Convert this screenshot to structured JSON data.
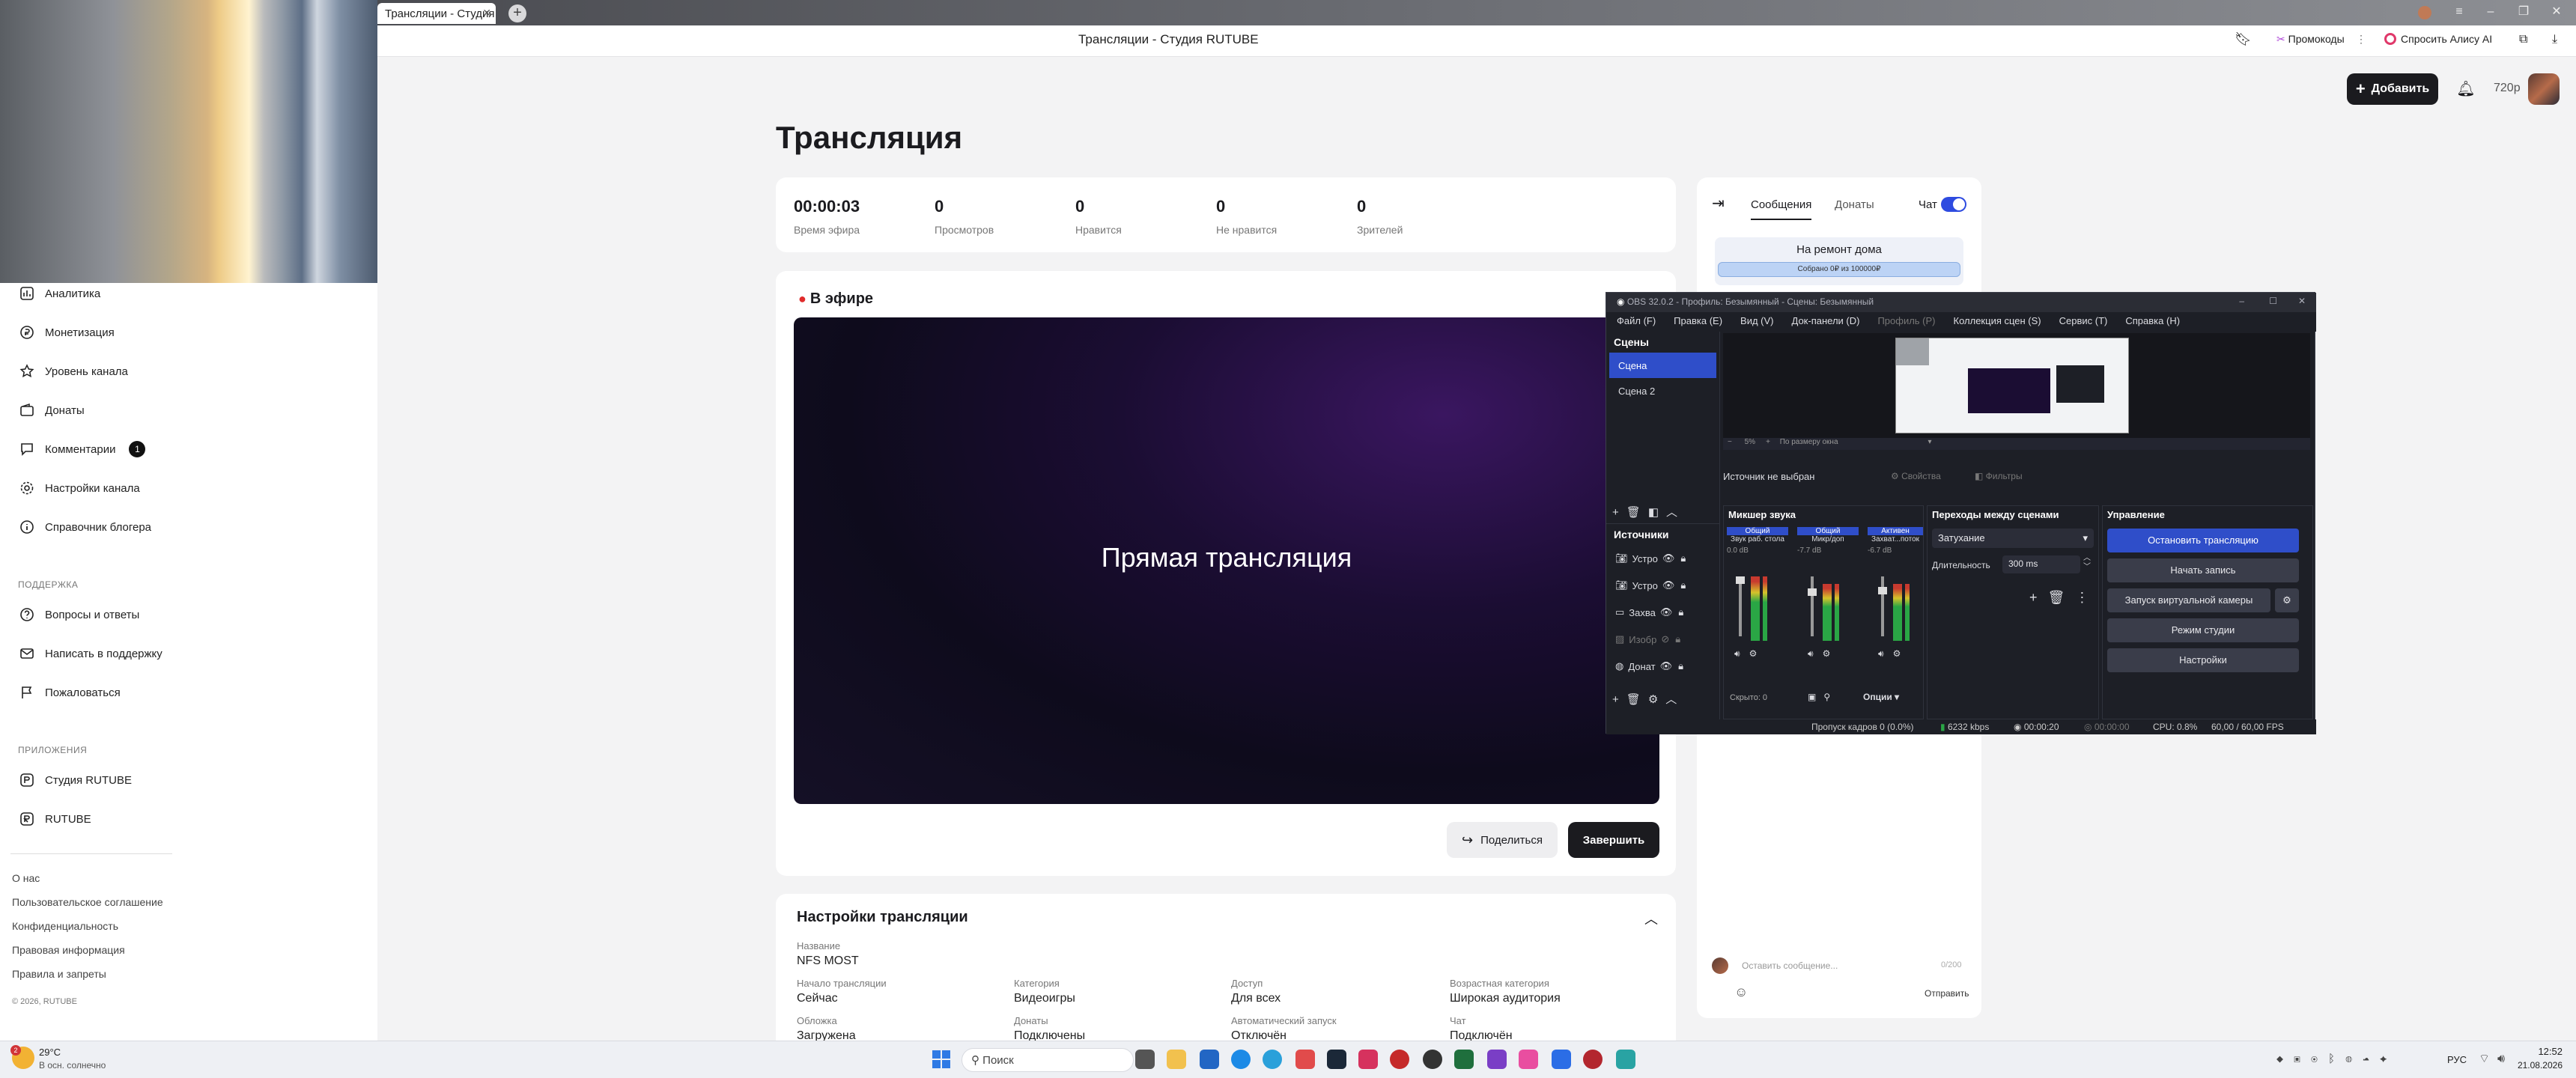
{
  "browser": {
    "tab_title": "Трансляции - Студия R",
    "page_title": "Трансляции - Студия RUTUBE",
    "actions": {
      "promo": "Промокоды",
      "ask": "Спросить Алису AI"
    }
  },
  "header": {
    "add_label": "Добавить",
    "quality": "720p"
  },
  "sidebar": {
    "items": [
      {
        "label": "Аналитика",
        "icon": "analytics-icon"
      },
      {
        "label": "Монетизация",
        "icon": "coin-icon"
      },
      {
        "label": "Уровень канала",
        "icon": "star-icon"
      },
      {
        "label": "Донаты",
        "icon": "wallet-icon"
      },
      {
        "label": "Комментарии",
        "icon": "comment-icon",
        "badge": "1"
      },
      {
        "label": "Настройки канала",
        "icon": "gear-icon"
      },
      {
        "label": "Справочник блогера",
        "icon": "info-icon"
      }
    ],
    "support_header": "ПОДДЕРЖКА",
    "support_items": [
      {
        "label": "Вопросы и ответы",
        "icon": "question-icon"
      },
      {
        "label": "Написать в поддержку",
        "icon": "mail-icon"
      },
      {
        "label": "Пожаловаться",
        "icon": "flag-icon"
      }
    ],
    "apps_header": "ПРИЛОЖЕНИЯ",
    "apps_items": [
      {
        "label": "Студия RUTUBE",
        "icon": "studio-icon"
      },
      {
        "label": "RUTUBE",
        "icon": "rutube-icon"
      }
    ],
    "footer_links": [
      "О нас",
      "Пользовательское соглашение",
      "Конфиденциальность",
      "Правовая информация",
      "Правила и запреты"
    ],
    "copyright": "© 2026, RUTUBE"
  },
  "main": {
    "title": "Трансляция",
    "stats": [
      {
        "value": "00:00:03",
        "label": "Время эфира"
      },
      {
        "value": "0",
        "label": "Просмотров"
      },
      {
        "value": "0",
        "label": "Нравится"
      },
      {
        "value": "0",
        "label": "Не нравится"
      },
      {
        "value": "0",
        "label": "Зрителей"
      }
    ],
    "live_label": "В эфире",
    "player_text": "Прямая трансляция",
    "share_label": "Поделиться",
    "finish_label": "Завершить",
    "settings": {
      "title": "Настройки трансляции",
      "name_label": "Название",
      "name_value": "NFS MOST",
      "fields": [
        {
          "label": "Начало трансляции",
          "value": "Сейчас"
        },
        {
          "label": "Категория",
          "value": "Видеоигры"
        },
        {
          "label": "Доступ",
          "value": "Для всех"
        },
        {
          "label": "Возрастная категория",
          "value": "Широкая аудитория"
        },
        {
          "label": "Обложка",
          "value": "Загружена"
        },
        {
          "label": "Донаты",
          "value": "Подключены"
        },
        {
          "label": "Автоматический запуск",
          "value": "Отключён"
        },
        {
          "label": "Чат",
          "value": "Подключён"
        }
      ]
    }
  },
  "chat": {
    "tabs": [
      "Сообщения",
      "Донаты"
    ],
    "chat_toggle_label": "Чат",
    "chat_enabled": true,
    "goal_title": "На ремонт дома",
    "goal_progress": "Собрано 0₽ из 100000₽",
    "goal_fraction": 0,
    "input_placeholder": "Оставить сообщение...",
    "char_count": "0/200",
    "send_label": "Отправить"
  },
  "obs": {
    "title": "OBS 32.0.2 - Профиль: Безымянный - Сцены: Безымянный",
    "menu": [
      "Файл (F)",
      "Правка (E)",
      "Вид (V)",
      "Док-панели (D)",
      "Профиль (P)",
      "Коллекция сцен (S)",
      "Сервис (T)",
      "Справка (H)"
    ],
    "scenes_header": "Сцены",
    "scenes": [
      "Сцена",
      "Сцена 2"
    ],
    "sources_header": "Источники",
    "sources": [
      "Устро",
      "Устро",
      "Захва",
      "Изобр",
      "Донат"
    ],
    "zoom": "5%",
    "zoom_mode": "По размеру окна",
    "no_source": "Источник не выбран",
    "properties": "Свойства",
    "filters": "Фильтры",
    "mixer_header": "Микшер звука",
    "mixer_channels": [
      {
        "tag": "Общий",
        "name": "Звук раб. стола",
        "db": "0.0 dB"
      },
      {
        "tag": "Общий",
        "name": "Микр/доп",
        "db": "-7.7 dB"
      },
      {
        "tag": "Активен",
        "name": "Захват...поток",
        "db": "-6.7 dB"
      }
    ],
    "hidden_label": "Скрыто: 0",
    "options_label": "Опции",
    "transitions_header": "Переходы между сценами",
    "transition_value": "Затухание",
    "duration_label": "Длительность",
    "duration_value": "300 ms",
    "controls_header": "Управление",
    "controls": [
      "Остановить трансляцию",
      "Начать запись",
      "Запуск виртуальной камеры",
      "Режим студии",
      "Настройки"
    ],
    "status": {
      "dropped": "Пропуск кадров 0 (0.0%)",
      "bitrate": "6232 kbps",
      "stream_time": "00:00:20",
      "rec_time": "00:00:00",
      "cpu": "CPU: 0.8%",
      "fps": "60,00 / 60,00 FPS"
    }
  },
  "taskbar": {
    "weather_temp": "29°C",
    "weather_desc": "В осн. солнечно",
    "search_placeholder": "Поиск",
    "lang": "РУС",
    "time": "12:52",
    "date": "21.08.2026"
  },
  "colors": {
    "accent_blue": "#2e4be0",
    "live_red": "#e02b2b",
    "dark": "#1b1b1f"
  }
}
